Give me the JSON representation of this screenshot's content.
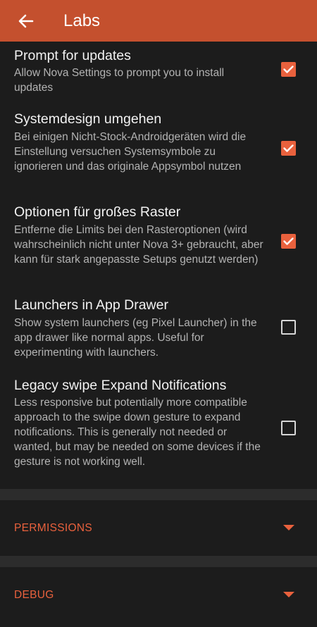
{
  "appbar": {
    "title": "Labs",
    "back_icon": "arrow-left-icon",
    "color": "#c4502e"
  },
  "settings": [
    {
      "title": "Prompt for updates",
      "description": "Allow Nova Settings to prompt you to install updates",
      "checked": true
    },
    {
      "title": "Systemdesign umgehen",
      "description": "Bei einigen Nicht-Stock-Androidgeräten wird die Einstellung versuchen Systemsymbole zu ignorieren und das originale Appsymbol nutzen",
      "checked": true
    },
    {
      "title": "Optionen für großes Raster",
      "description": "Entferne die Limits bei den Rasteroptionen (wird wahrscheinlich nicht unter Nova 3+ gebraucht, aber kann für stark angepasste Setups genutzt werden)",
      "checked": true
    },
    {
      "title": "Launchers in App Drawer",
      "description": "Show system launchers (eg Pixel Launcher) in the app drawer like normal apps. Useful for experimenting with launchers.",
      "checked": false
    },
    {
      "title": "Legacy swipe Expand Notifications",
      "description": "Less responsive but potentially more compatible approach to the swipe down gesture to expand notifications. This is generally not needed or wanted, but may be needed on some devices if the gesture is not working well.",
      "checked": false
    }
  ],
  "sections": [
    {
      "label": "PERMISSIONS",
      "icon": "chevron-down-icon"
    },
    {
      "label": "DEBUG",
      "icon": "chevron-down-icon"
    }
  ],
  "colors": {
    "accent": "#e9613d",
    "background": "#1c1c1c",
    "divider": "#2c2c2c"
  }
}
